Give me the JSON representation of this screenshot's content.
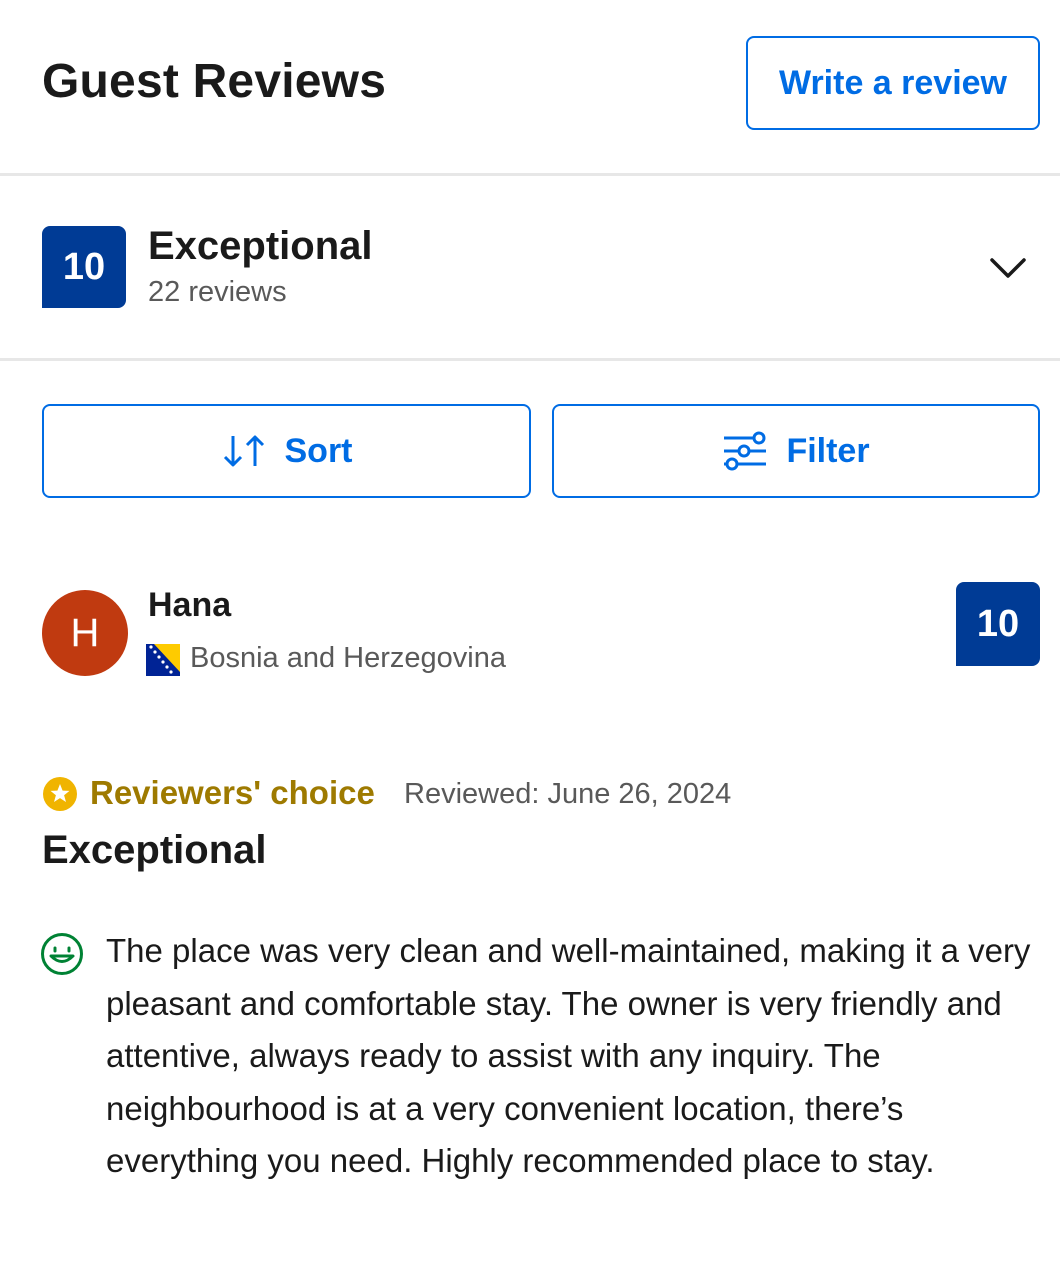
{
  "header": {
    "title": "Guest Reviews",
    "write_review_label": "Write a review"
  },
  "summary": {
    "score": "10",
    "rating_word": "Exceptional",
    "review_count": "22 reviews"
  },
  "actions": {
    "sort_label": "Sort",
    "filter_label": "Filter"
  },
  "review": {
    "avatar_initial": "H",
    "reviewer_name": "Hana",
    "country": "Bosnia and Herzegovina",
    "score": "10",
    "badge_label": "Reviewers' choice",
    "date": "Reviewed: June 26, 2024",
    "title": "Exceptional",
    "body": "The place was very clean and well-maintained, making it a very pleasant and comfortable stay. The owner is very friendly and attentive, always ready to assist with any inquiry. The neighbourhood is at a very convenient location, there’s everything you need. Highly recommended place to stay."
  },
  "colors": {
    "accent": "#006ce4",
    "score_badge": "#003b95",
    "avatar": "#c03a10",
    "reviewers_choice": "#9e7a00",
    "positive": "#008234"
  },
  "icons": {
    "expand": "chevron-down-icon",
    "sort": "sort-arrows-icon",
    "filter": "filter-sliders-icon",
    "badge": "star-badge-icon",
    "positive": "smile-icon",
    "flag": "bosnia-flag-icon"
  }
}
